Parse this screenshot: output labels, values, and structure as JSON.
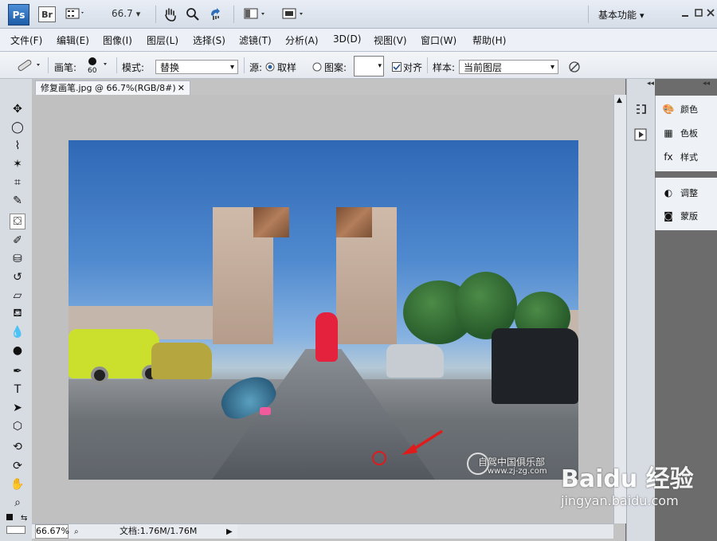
{
  "app": {
    "logo": "Ps",
    "bridge_logo": "Br",
    "zoom_label": "66.7",
    "workspace": "基本功能"
  },
  "menu": [
    "文件(F)",
    "编辑(E)",
    "图像(I)",
    "图层(L)",
    "选择(S)",
    "滤镜(T)",
    "分析(A)",
    "3D(D)",
    "视图(V)",
    "窗口(W)",
    "帮助(H)"
  ],
  "options": {
    "brush_label": "画笔:",
    "brush_size": "60",
    "mode_label": "模式:",
    "mode_value": "替换",
    "source_label": "源:",
    "sample_option": "取样",
    "pattern_option": "图案:",
    "align_label": "对齐",
    "sample_label": "样本:",
    "sample_value": "当前图层"
  },
  "document": {
    "tab_title": "修复画笔.jpg @ 66.7%(RGB/8#)",
    "close_symbol": "✕",
    "zoom_status": "66.67%",
    "doc_info": "文档:1.76M/1.76M"
  },
  "image": {
    "watermark_site": "自驾中国俱乐部",
    "watermark_url": "www.zj-zg.com"
  },
  "panels": {
    "group1": [
      "颜色",
      "色板",
      "样式"
    ],
    "group2": [
      "调整",
      "蒙版"
    ]
  },
  "baidu": {
    "brand": "Baidu 经验",
    "url": "jingyan.baidu.com"
  },
  "icons": {
    "hand": "hand-icon",
    "zoom": "zoom-icon",
    "rotate": "rotate-view-icon"
  }
}
